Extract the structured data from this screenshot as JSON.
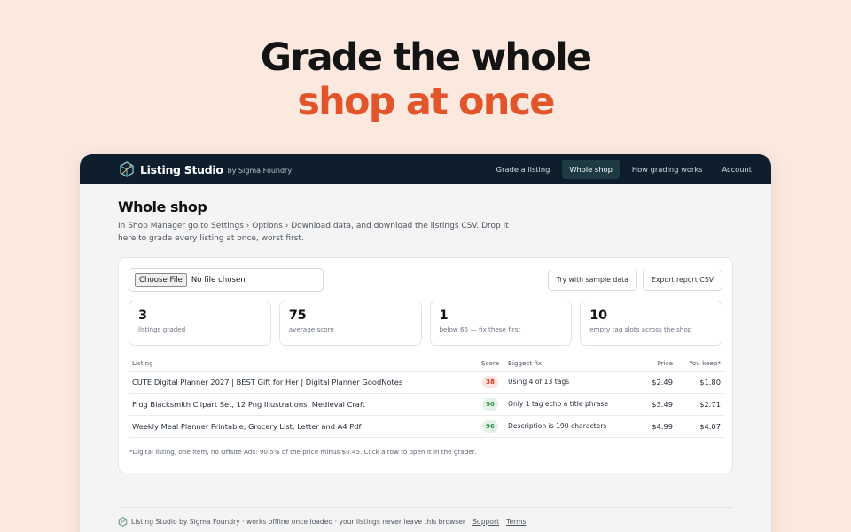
{
  "hero": {
    "line1": "Grade the whole",
    "line2": "shop at once"
  },
  "nav": {
    "brand": "Listing Studio",
    "brand_sub": "by Sigma Foundry",
    "links": [
      "Grade a listing",
      "Whole shop",
      "How grading works",
      "Account"
    ],
    "active": "Whole shop"
  },
  "page": {
    "title": "Whole shop",
    "description": "In Shop Manager go to Settings › Options › Download data, and download the listings CSV. Drop it here to grade every listing at once, worst first."
  },
  "upload": {
    "button": "Choose File",
    "status": "No file chosen"
  },
  "actions": {
    "sample": "Try with sample data",
    "export": "Export report CSV"
  },
  "stats": [
    {
      "value": "3",
      "label": "listings graded"
    },
    {
      "value": "75",
      "label": "average score"
    },
    {
      "value": "1",
      "label": "below 65 — fix these first"
    },
    {
      "value": "10",
      "label": "empty tag slots across the shop"
    }
  ],
  "table": {
    "headers": {
      "listing": "Listing",
      "score": "Score",
      "fix": "Biggest fix",
      "price": "Price",
      "keep": "You keep*"
    },
    "rows": [
      {
        "listing": "CUTE Digital Planner 2027 | BEST Gift for Her | Digital Planner GoodNotes",
        "score": "38",
        "fix": "Using 4 of 13 tags",
        "price": "$2.49",
        "keep": "$1.80",
        "status": "bad"
      },
      {
        "listing": "Frog Blacksmith Clipart Set, 12 Png Illustrations, Medieval Craft",
        "score": "90",
        "fix": "Only 1 tag echo a title phrase",
        "price": "$3.49",
        "keep": "$2.71",
        "status": "good"
      },
      {
        "listing": "Weekly Meal Planner Printable, Grocery List, Letter and A4 Pdf",
        "score": "96",
        "fix": "Description is 190 characters",
        "price": "$4.99",
        "keep": "$4.07",
        "status": "good"
      }
    ],
    "footnote": "*Digital listing, one item, no Offsite Ads: 90.5% of the price minus $0.45. Click a row to open it in the grader."
  },
  "footer": {
    "text": "Listing Studio by Sigma Foundry · works offline once loaded · your listings never leave this browser",
    "links": [
      "Support",
      "Terms"
    ]
  },
  "colors": {
    "accent": "#e2542a",
    "nav_bg": "#0f1e2d",
    "active_tab": "#1e3a43",
    "score_bad": "#c93a23",
    "score_good": "#2f8a49"
  },
  "icons": {
    "logo": "crystal-logo-icon"
  }
}
